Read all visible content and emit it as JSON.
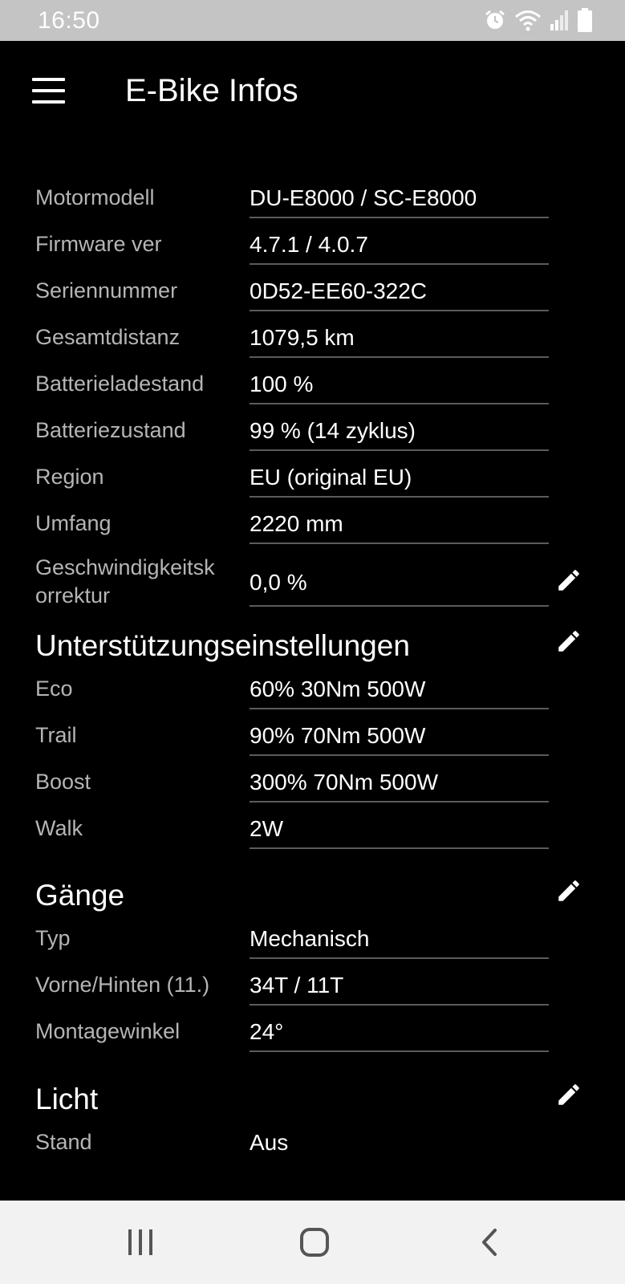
{
  "status": {
    "time": "16:50"
  },
  "appbar": {
    "title": "E-Bike Infos"
  },
  "info": [
    {
      "label": "Motormodell",
      "value": "DU-E8000 / SC-E8000"
    },
    {
      "label": "Firmware ver",
      "value": "4.7.1 / 4.0.7"
    },
    {
      "label": "Seriennummer",
      "value": "0D52-EE60-322C"
    },
    {
      "label": "Gesamtdistanz",
      "value": "1079,5 km"
    },
    {
      "label": "Batterieladestand",
      "value": "100 %"
    },
    {
      "label": "Batteriezustand",
      "value": "99 % (14 zyklus)"
    },
    {
      "label": "Region",
      "value": "EU (original EU)"
    },
    {
      "label": "Umfang",
      "value": "2220 mm"
    }
  ],
  "speed_correction": {
    "label": "Geschwindigkeitskorrektur",
    "label_line1": "Geschwindigkeitsk",
    "label_line2": "orrektur",
    "value": "0,0 %"
  },
  "assist": {
    "title": "Unterstützungseinstellungen",
    "rows": [
      {
        "label": "Eco",
        "value": "60% 30Nm 500W"
      },
      {
        "label": "Trail",
        "value": "90% 70Nm 500W"
      },
      {
        "label": "Boost",
        "value": "300% 70Nm 500W"
      },
      {
        "label": "Walk",
        "value": "2W"
      }
    ]
  },
  "gears": {
    "title": "Gänge",
    "rows": [
      {
        "label": "Typ",
        "value": "Mechanisch"
      },
      {
        "label": "Vorne/Hinten (11.)",
        "value": "34T / 11T"
      },
      {
        "label": "Montagewinkel",
        "value": "24°"
      }
    ]
  },
  "light": {
    "title": "Licht",
    "rows": [
      {
        "label": "Stand",
        "value": "Aus"
      }
    ]
  },
  "icons": {
    "menu": "hamburger-menu-icon",
    "edit": "pencil-icon",
    "status": [
      "alarm-icon",
      "wifi-icon",
      "signal-icon",
      "battery-icon"
    ],
    "nav": [
      "recent-apps-icon",
      "home-icon",
      "back-icon"
    ]
  },
  "colors": {
    "background": "#000000",
    "label": "#b5b5b5",
    "value": "#ffffff",
    "divider": "#5b5b5b",
    "statusbar": "#c4c4c4",
    "navbar": "#f2f2f2"
  }
}
